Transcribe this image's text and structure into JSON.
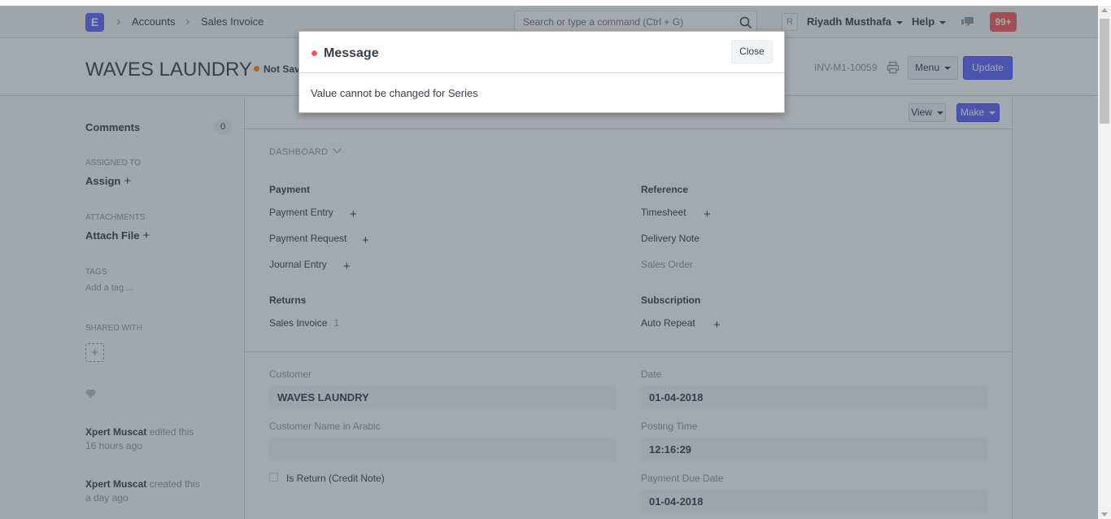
{
  "navbar": {
    "logo_letter": "E",
    "breadcrumbs": [
      "Accounts",
      "Sales Invoice"
    ],
    "search_placeholder": "Search or type a command (Ctrl + G)",
    "avatar_letter": "R",
    "user_name": "Riyadh Musthafa",
    "help_label": "Help",
    "notification_count": "99+"
  },
  "page_head": {
    "title": "WAVES LAUNDRY",
    "status": "Not Saved",
    "doc_name": "INV-M1-10059",
    "menu_label": "Menu",
    "update_label": "Update"
  },
  "sidebar": {
    "comments_label": "Comments",
    "comments_count": "0",
    "assigned_to_label": "ASSIGNED TO",
    "assign_label": "Assign",
    "attachments_label": "ATTACHMENTS",
    "attach_label": "Attach File",
    "tags_label": "TAGS",
    "add_tag_label": "Add a tag ...",
    "shared_with_label": "SHARED WITH",
    "activity": [
      {
        "user": "Xpert Muscat",
        "action": "edited this",
        "time": "16 hours ago"
      },
      {
        "user": "Xpert Muscat",
        "action": "created this",
        "time": "a day ago"
      }
    ]
  },
  "form": {
    "view_label": "View",
    "make_label": "Make",
    "dashboard_label": "DASHBOARD",
    "groups": {
      "payment": {
        "title": "Payment",
        "links": [
          "Payment Entry",
          "Payment Request",
          "Journal Entry"
        ]
      },
      "reference": {
        "title": "Reference",
        "links": [
          "Timesheet",
          "Delivery Note",
          "Sales Order"
        ]
      },
      "returns": {
        "title": "Returns",
        "links": [
          "Sales Invoice"
        ],
        "count": "1"
      },
      "subscription": {
        "title": "Subscription",
        "links": [
          "Auto Repeat"
        ]
      }
    },
    "fields": {
      "customer_label": "Customer",
      "customer_value": "WAVES LAUNDRY",
      "customer_arabic_label": "Customer Name in Arabic",
      "customer_arabic_value": "",
      "is_return_label": "Is Return (Credit Note)",
      "date_label": "Date",
      "date_value": "01-04-2018",
      "posting_time_label": "Posting Time",
      "posting_time_value": "12:16:29",
      "due_date_label": "Payment Due Date",
      "due_date_value": "01-04-2018"
    }
  },
  "modal": {
    "title": "Message",
    "close_label": "Close",
    "message": "Value cannot be changed for Series"
  },
  "colors": {
    "primary": "#5e64ff",
    "danger": "#ff5858",
    "warning": "#ff8a00",
    "text": "#36414c",
    "muted": "#8d99a6"
  }
}
